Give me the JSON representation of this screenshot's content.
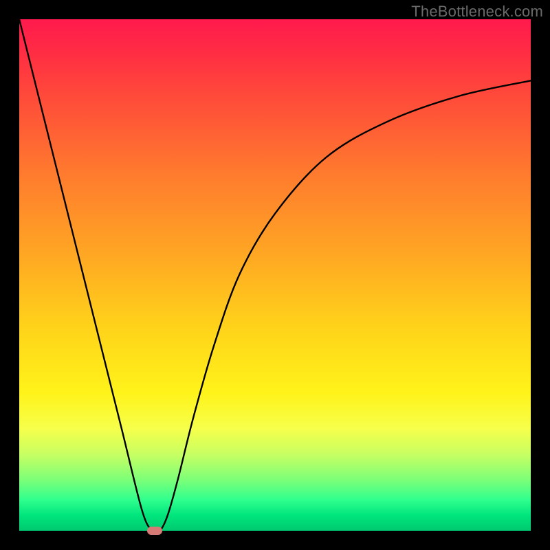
{
  "watermark": "TheBottleneck.com",
  "chart_data": {
    "type": "line",
    "title": "",
    "xlabel": "",
    "ylabel": "",
    "xlim": [
      0,
      100
    ],
    "ylim": [
      0,
      100
    ],
    "grid": false,
    "legend": false,
    "series": [
      {
        "name": "curve",
        "x": [
          0,
          5,
          10,
          15,
          20,
          24,
          26,
          27.5,
          29,
          31,
          34,
          38,
          43,
          50,
          60,
          72,
          86,
          100
        ],
        "values": [
          100,
          80,
          60,
          40,
          20,
          4,
          0,
          0,
          3,
          10,
          22,
          36,
          50,
          62,
          73,
          80,
          85,
          88
        ]
      }
    ],
    "annotations": [
      {
        "name": "min-marker",
        "x": 26.5,
        "y": 0
      }
    ],
    "background_gradient": {
      "direction": "top-to-bottom",
      "stops": [
        {
          "pct": 0,
          "color": "#ff1a4d"
        },
        {
          "pct": 30,
          "color": "#ff7a2e"
        },
        {
          "pct": 60,
          "color": "#ffd21a"
        },
        {
          "pct": 80,
          "color": "#f6ff4a"
        },
        {
          "pct": 100,
          "color": "#00c96f"
        }
      ]
    }
  }
}
